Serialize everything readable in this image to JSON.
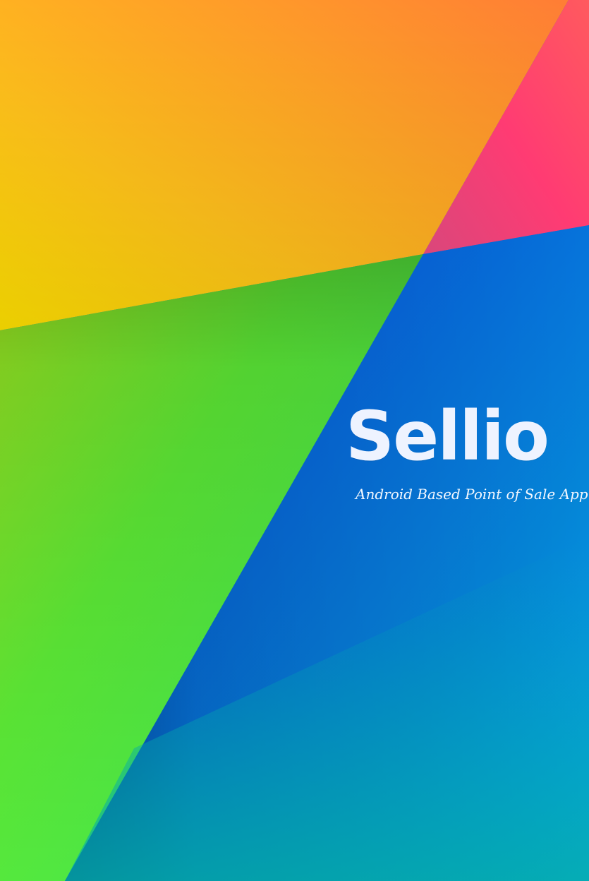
{
  "brand": {
    "title": "Sellio",
    "tagline": "Android Based Point of Sale App"
  },
  "colors": {
    "orange": "#ff9a2e",
    "yellow": "#ffc400",
    "pink": "#ff2f6e",
    "green": "#4be643",
    "blue": "#0a68e6",
    "teal": "#09a6b8",
    "text": "#eef3ff"
  }
}
